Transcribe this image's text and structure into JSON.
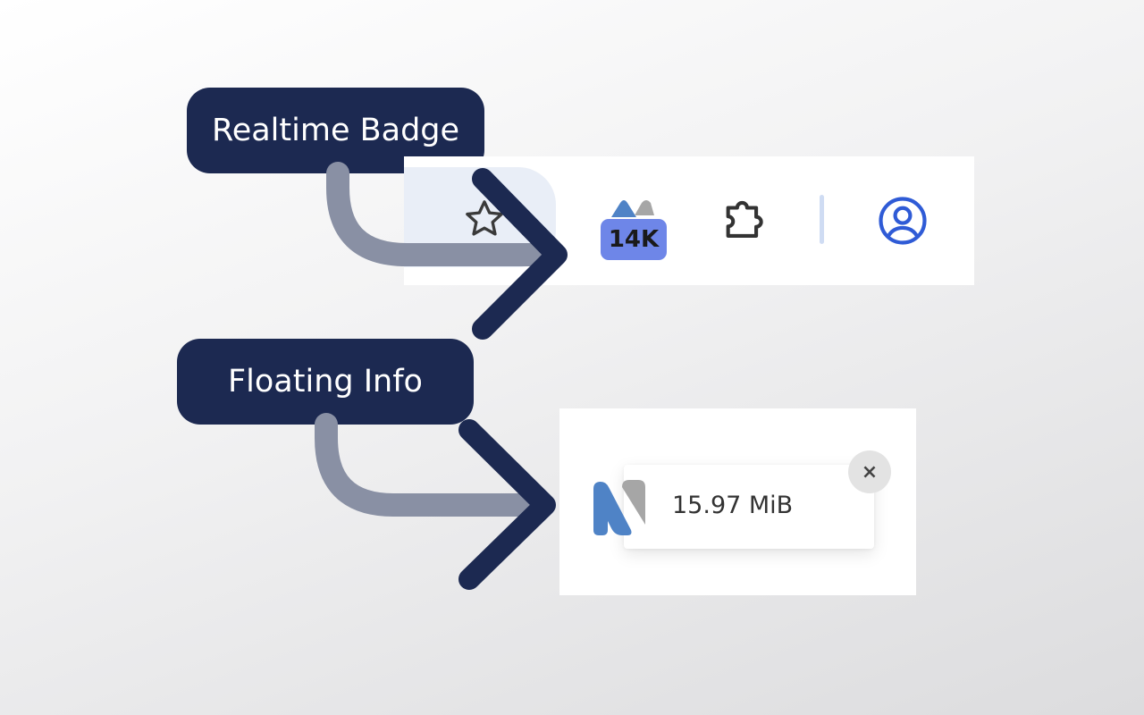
{
  "labels": {
    "realtime_badge": "Realtime Badge",
    "floating_info": "Floating Info"
  },
  "toolbar": {
    "badge_count": "14K",
    "icons": [
      "star-icon",
      "extension-icon",
      "puzzle-icon",
      "profile-icon"
    ]
  },
  "floating": {
    "size_text": "15.97 MiB",
    "close_symbol": "×"
  },
  "colors": {
    "pill": "#1c2951",
    "arrow_tail": "#8990a4",
    "badge": "#6e86e8",
    "profile": "#2f5bd6",
    "logo_blue": "#4f83c6",
    "logo_gray": "#a6a6a6"
  }
}
